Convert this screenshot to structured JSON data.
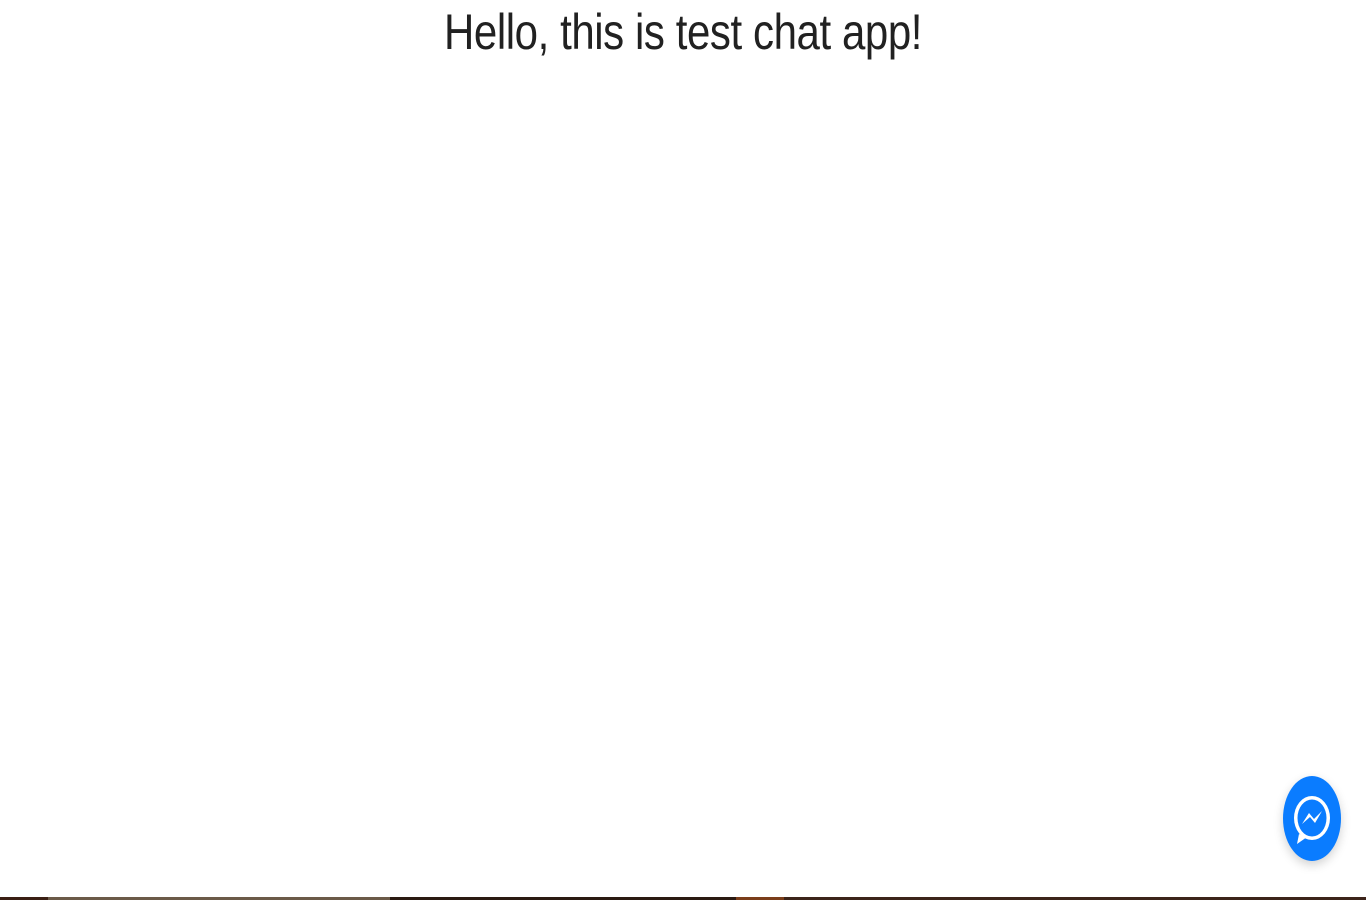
{
  "page": {
    "heading": "Hello, this is test chat app!"
  },
  "chat_widget": {
    "icon": "messenger-icon",
    "accent_color": "#0a7cff"
  },
  "colors": {
    "background": "#ffffff",
    "text": "#212121",
    "taskbar_strip": [
      "#3a1f14",
      "#6b5a48",
      "#2a1a12",
      "#7a3d1a",
      "#3c241a"
    ]
  }
}
